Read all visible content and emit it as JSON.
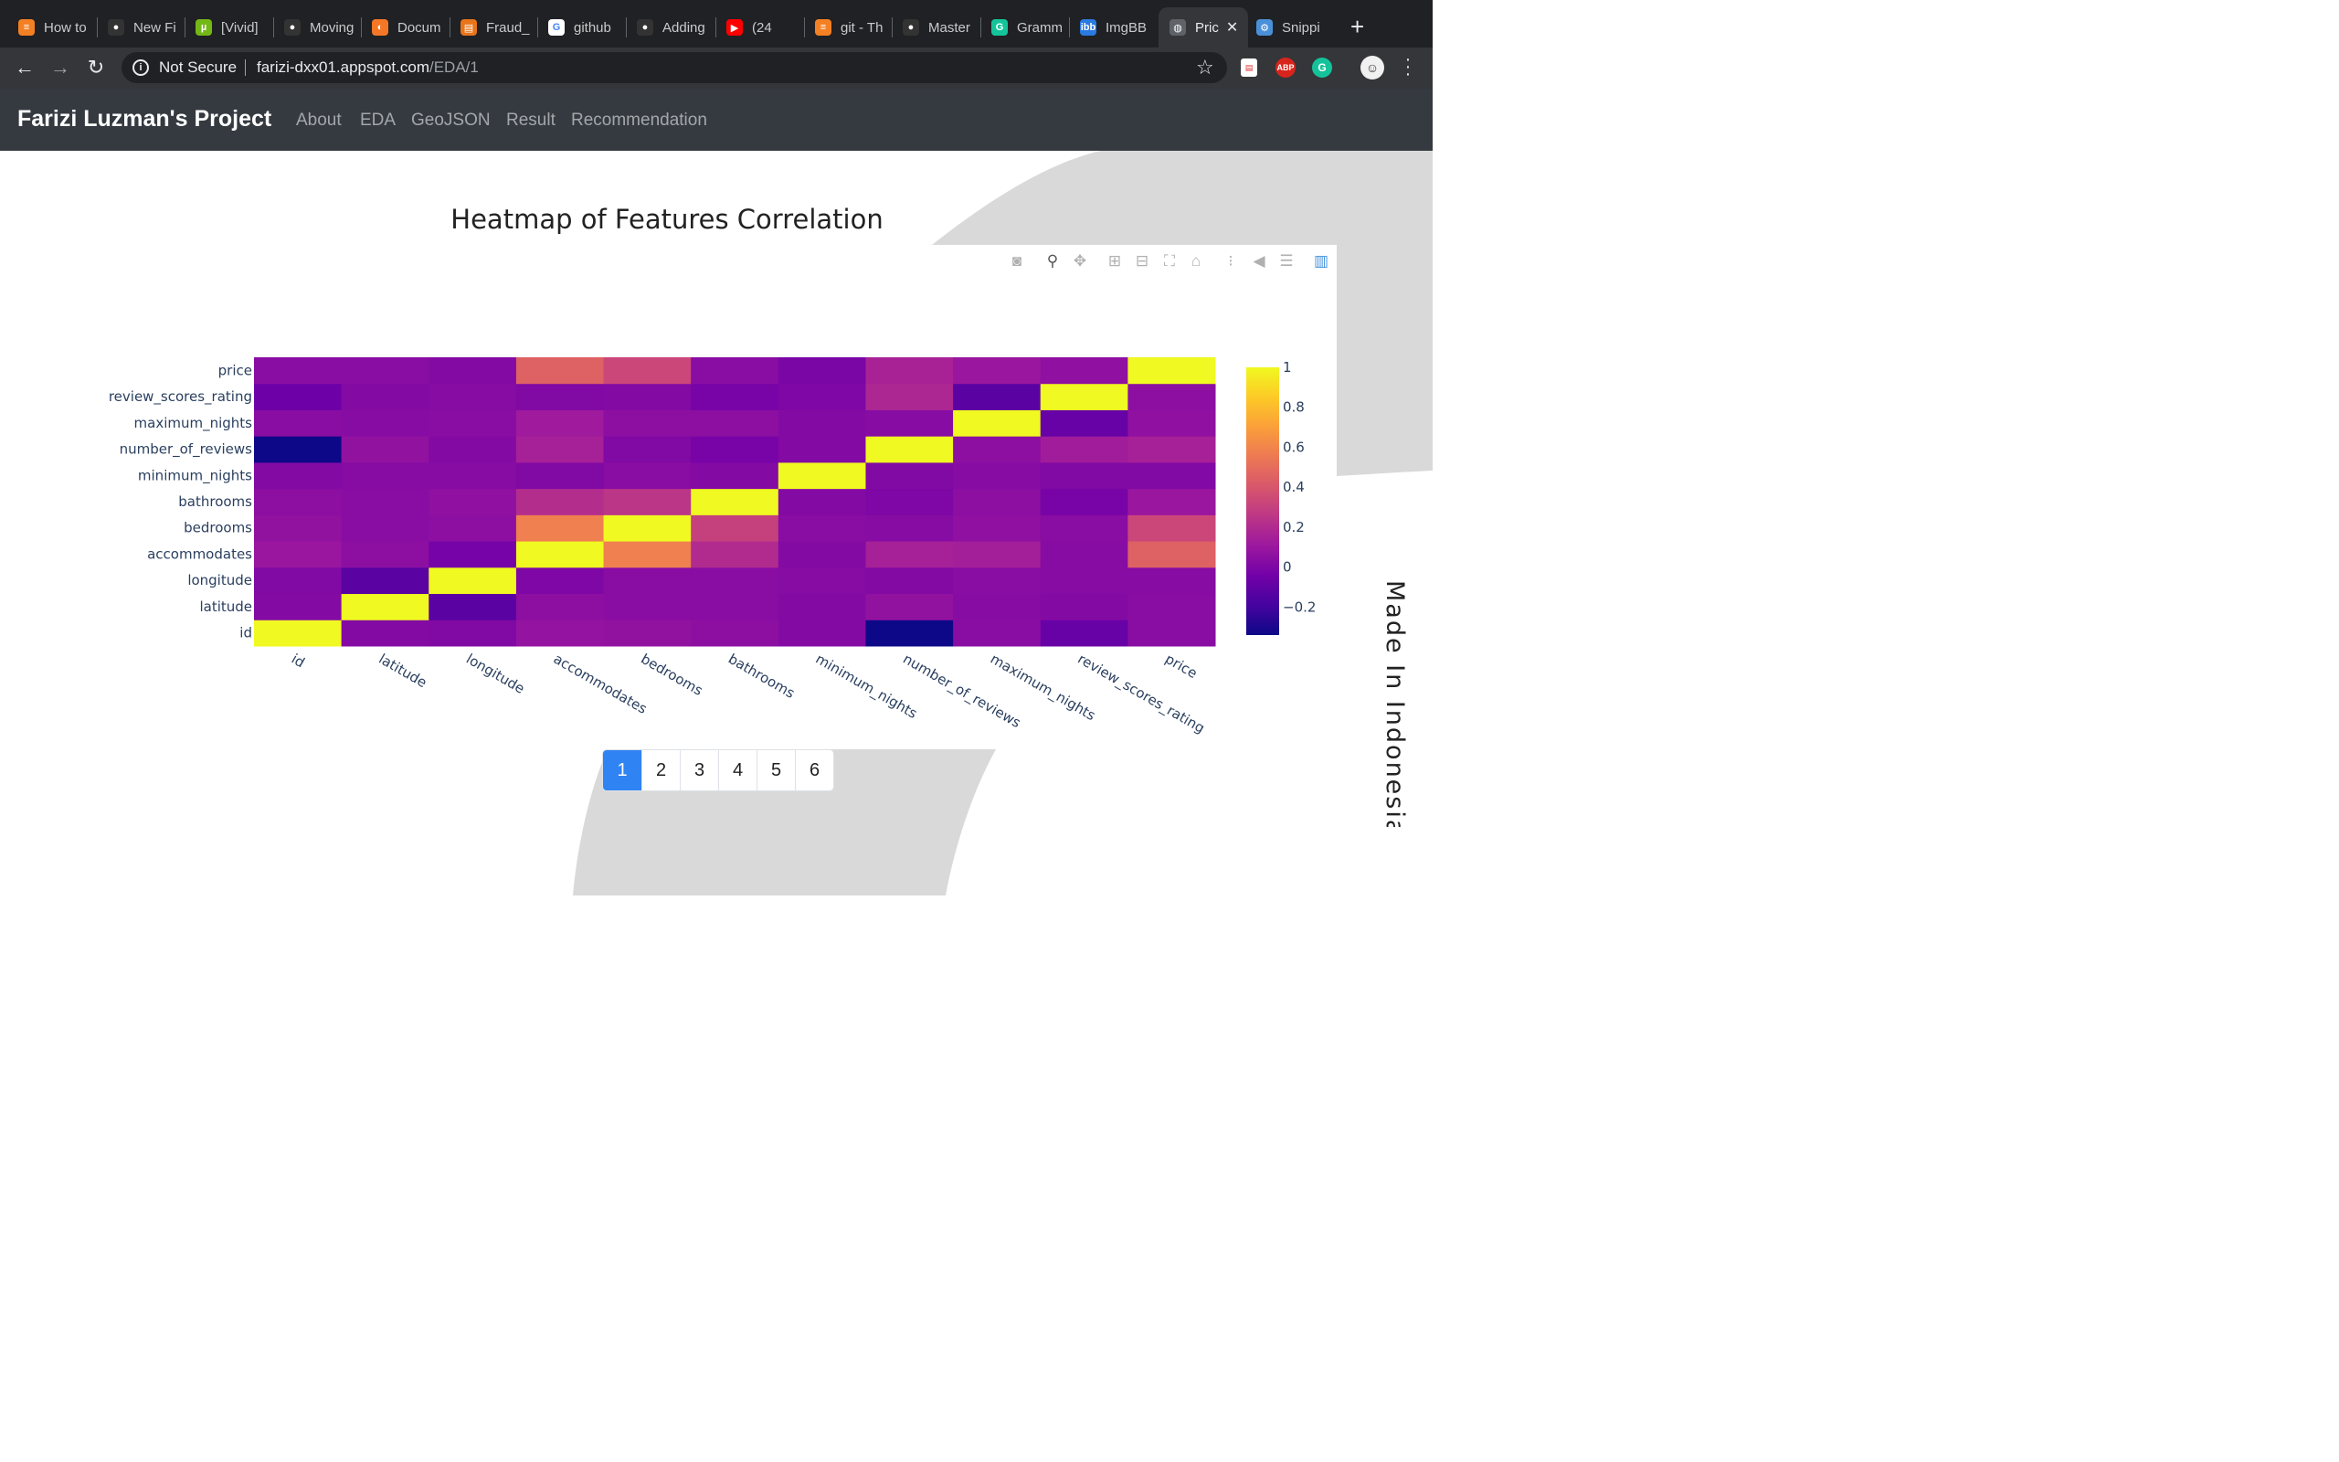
{
  "browser": {
    "tabs": [
      {
        "label": "How to",
        "color": "#f48024",
        "glyph": "≡"
      },
      {
        "label": "New Fi",
        "color": "#333333",
        "glyph": "●"
      },
      {
        "label": "[Vivid]",
        "color": "#74b816",
        "glyph": "µ"
      },
      {
        "label": "Moving",
        "color": "#333333",
        "glyph": "●"
      },
      {
        "label": "Docum",
        "color": "#f37726",
        "glyph": "◐"
      },
      {
        "label": "Fraud_",
        "color": "#e8741b",
        "glyph": "▤"
      },
      {
        "label": "github",
        "color": "#ffffff",
        "glyph": "G"
      },
      {
        "label": "Adding",
        "color": "#333333",
        "glyph": "●"
      },
      {
        "label": "(24",
        "color": "#ff0000",
        "glyph": "▶"
      },
      {
        "label": "git - Th",
        "color": "#f48024",
        "glyph": "≡"
      },
      {
        "label": "Master",
        "color": "#333333",
        "glyph": "●"
      },
      {
        "label": "Gramm",
        "color": "#15c39a",
        "glyph": "G"
      },
      {
        "label": "ImgBB",
        "color": "#2a7ae2",
        "glyph": "ibb"
      },
      {
        "label": "Pric",
        "color": "#5f6368",
        "glyph": "◍"
      },
      {
        "label": "Snippi",
        "color": "#4a90d9",
        "glyph": "⚙"
      }
    ],
    "active_tab_index": 13,
    "security_label": "Not Secure",
    "url_host": "farizi-dxx01.appspot.com",
    "url_path": "/EDA/1"
  },
  "site": {
    "brand": "Farizi Luzman's Project",
    "nav": [
      "About",
      "EDA",
      "GeoJSON",
      "Result",
      "Recommendation"
    ]
  },
  "footer_text": "Made In Indonesia",
  "pagination": [
    "1",
    "2",
    "3",
    "4",
    "5",
    "6"
  ],
  "pagination_active": "1",
  "colors": {
    "accent_blue": "#2f83f3",
    "nav_bg": "#343a40",
    "scale": [
      "#0d0887",
      "#46039f",
      "#7201a8",
      "#9c179e",
      "#bd3786",
      "#d8576b",
      "#ed7953",
      "#fb9f3a",
      "#fdca26",
      "#f0f921"
    ]
  },
  "chart_data": {
    "type": "heatmap",
    "title": "Heatmap of Features Correlation",
    "x": [
      "id",
      "latitude",
      "longitude",
      "accommodates",
      "bedrooms",
      "bathrooms",
      "minimum_nights",
      "number_of_reviews",
      "maximum_nights",
      "review_scores_rating",
      "price"
    ],
    "y": [
      "id",
      "latitude",
      "longitude",
      "accommodates",
      "bedrooms",
      "bathrooms",
      "minimum_nights",
      "number_of_reviews",
      "maximum_nights",
      "review_scores_rating",
      "price"
    ],
    "z": [
      [
        1.0,
        0.02,
        0.01,
        0.08,
        0.07,
        0.05,
        0.02,
        -0.34,
        0.04,
        -0.08,
        0.04
      ],
      [
        0.02,
        1.0,
        -0.12,
        0.05,
        0.04,
        0.04,
        0.02,
        0.07,
        0.03,
        0.02,
        0.04
      ],
      [
        0.01,
        -0.12,
        1.0,
        0.0,
        0.04,
        0.04,
        0.03,
        0.02,
        0.04,
        0.03,
        0.03
      ],
      [
        0.1,
        0.05,
        -0.03,
        1.0,
        0.58,
        0.2,
        0.02,
        0.15,
        0.14,
        0.03,
        0.45
      ],
      [
        0.07,
        0.04,
        0.05,
        0.58,
        1.0,
        0.3,
        0.04,
        0.03,
        0.06,
        0.04,
        0.33
      ],
      [
        0.05,
        0.04,
        0.06,
        0.21,
        0.25,
        1.0,
        0.02,
        0.0,
        0.05,
        -0.02,
        0.1
      ],
      [
        0.02,
        0.03,
        0.03,
        0.01,
        0.04,
        0.02,
        1.0,
        0.01,
        0.03,
        0.01,
        0.01
      ],
      [
        -0.34,
        0.07,
        0.02,
        0.15,
        0.01,
        -0.02,
        0.02,
        1.0,
        0.05,
        0.13,
        0.15
      ],
      [
        0.04,
        0.03,
        0.04,
        0.12,
        0.05,
        0.05,
        0.02,
        0.03,
        1.0,
        -0.08,
        0.06
      ],
      [
        -0.06,
        0.02,
        0.03,
        0.01,
        0.02,
        -0.02,
        0.0,
        0.18,
        -0.12,
        1.0,
        0.05
      ],
      [
        0.04,
        0.04,
        0.02,
        0.45,
        0.33,
        0.04,
        -0.01,
        0.16,
        0.1,
        0.06,
        1.0
      ]
    ],
    "zmin": -0.34,
    "zmax": 1.0,
    "colorscale": "Plasma",
    "colorbar_ticks": [
      "1",
      "0.8",
      "0.6",
      "0.4",
      "0.2",
      "0",
      "−0.2"
    ],
    "colorbar_tick_values": [
      1,
      0.8,
      0.6,
      0.4,
      0.2,
      0,
      -0.2
    ],
    "xlabel": "",
    "ylabel": ""
  }
}
